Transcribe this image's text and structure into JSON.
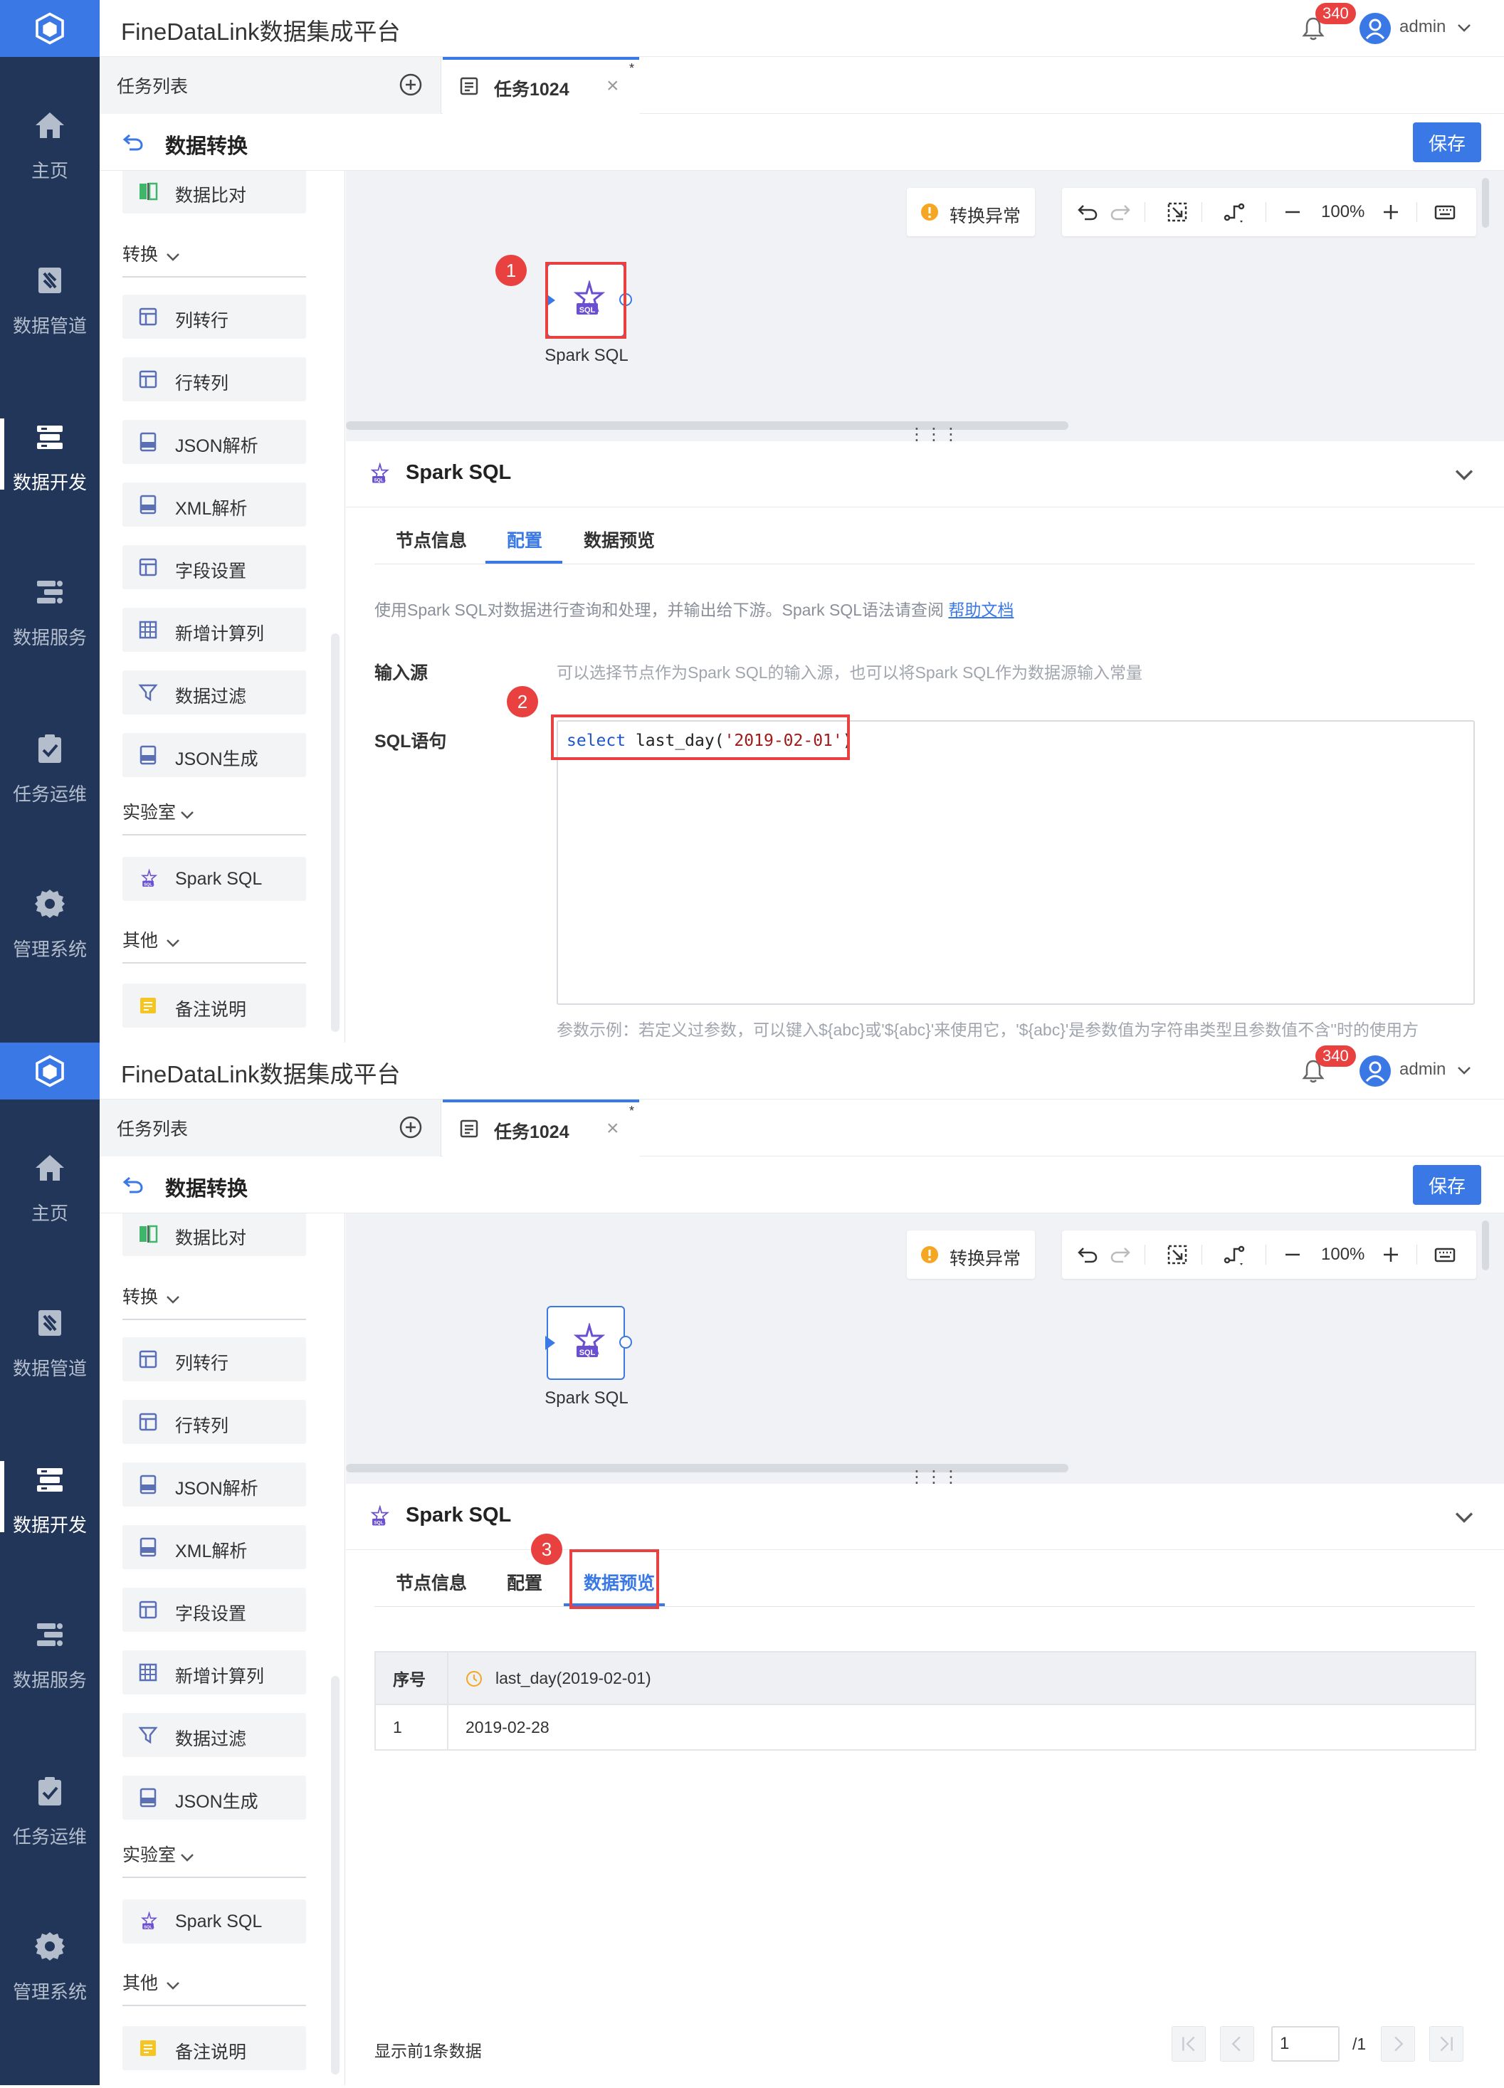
{
  "app": {
    "title": "FineDataLink数据集成平台",
    "notification_count": "340",
    "user": "admin"
  },
  "nav": [
    {
      "label": "主页",
      "icon": "home-icon"
    },
    {
      "label": "数据管道",
      "icon": "pipeline-icon"
    },
    {
      "label": "数据开发",
      "icon": "dev-icon",
      "active": true
    },
    {
      "label": "数据服务",
      "icon": "service-icon"
    },
    {
      "label": "任务运维",
      "icon": "ops-icon"
    },
    {
      "label": "管理系统",
      "icon": "gear-icon"
    }
  ],
  "tabs": {
    "task_list": "任务列表",
    "current_tab": "任务1024",
    "modified_mark": "*"
  },
  "breadcrumb": {
    "title": "数据转换",
    "save": "保存"
  },
  "palette": {
    "items_top": [
      "数据比对"
    ],
    "group_transform": "转换",
    "transform_items": [
      "列转行",
      "行转列",
      "JSON解析",
      "XML解析",
      "字段设置",
      "新增计算列",
      "数据过滤",
      "JSON生成"
    ],
    "group_lab": "实验室",
    "lab_items": [
      "Spark SQL"
    ],
    "group_other": "其他",
    "other_items": [
      "备注说明"
    ]
  },
  "canvas": {
    "warning": "转换异常",
    "zoom": "100%",
    "node_label": "Spark SQL"
  },
  "detail": {
    "title": "Spark SQL",
    "tab_node_info": "节点信息",
    "tab_config": "配置",
    "tab_preview": "数据预览",
    "description": "使用Spark SQL对数据进行查询和处理，并输出给下游。Spark SQL语法请查阅",
    "help_link": "帮助文档",
    "input_label": "输入源",
    "input_hint": "可以选择节点作为Spark SQL的输入源，也可以将Spark SQL作为数据源输入常量",
    "sql_label": "SQL语句",
    "sql_keyword": "select",
    "sql_func": " last_day(",
    "sql_string": "'2019-02-01'",
    "sql_close": ")",
    "param_hint": "参数示例：若定义过参数，可以键入${abc}或'${abc}'来使用它，'${abc}'是参数值为字符串类型且参数值不含''时的使用方"
  },
  "preview": {
    "header_index": "序号",
    "header_col": "last_day(2019-02-01)",
    "rows": [
      {
        "index": "1",
        "value": "2019-02-28"
      }
    ],
    "footer": "显示前1条数据",
    "page_input": "1",
    "page_total": "/1"
  },
  "markers": [
    "1",
    "2",
    "3"
  ],
  "colors": {
    "sidebar": "#22365a",
    "accent": "#3a78e6",
    "highlight": "#e8413f"
  }
}
